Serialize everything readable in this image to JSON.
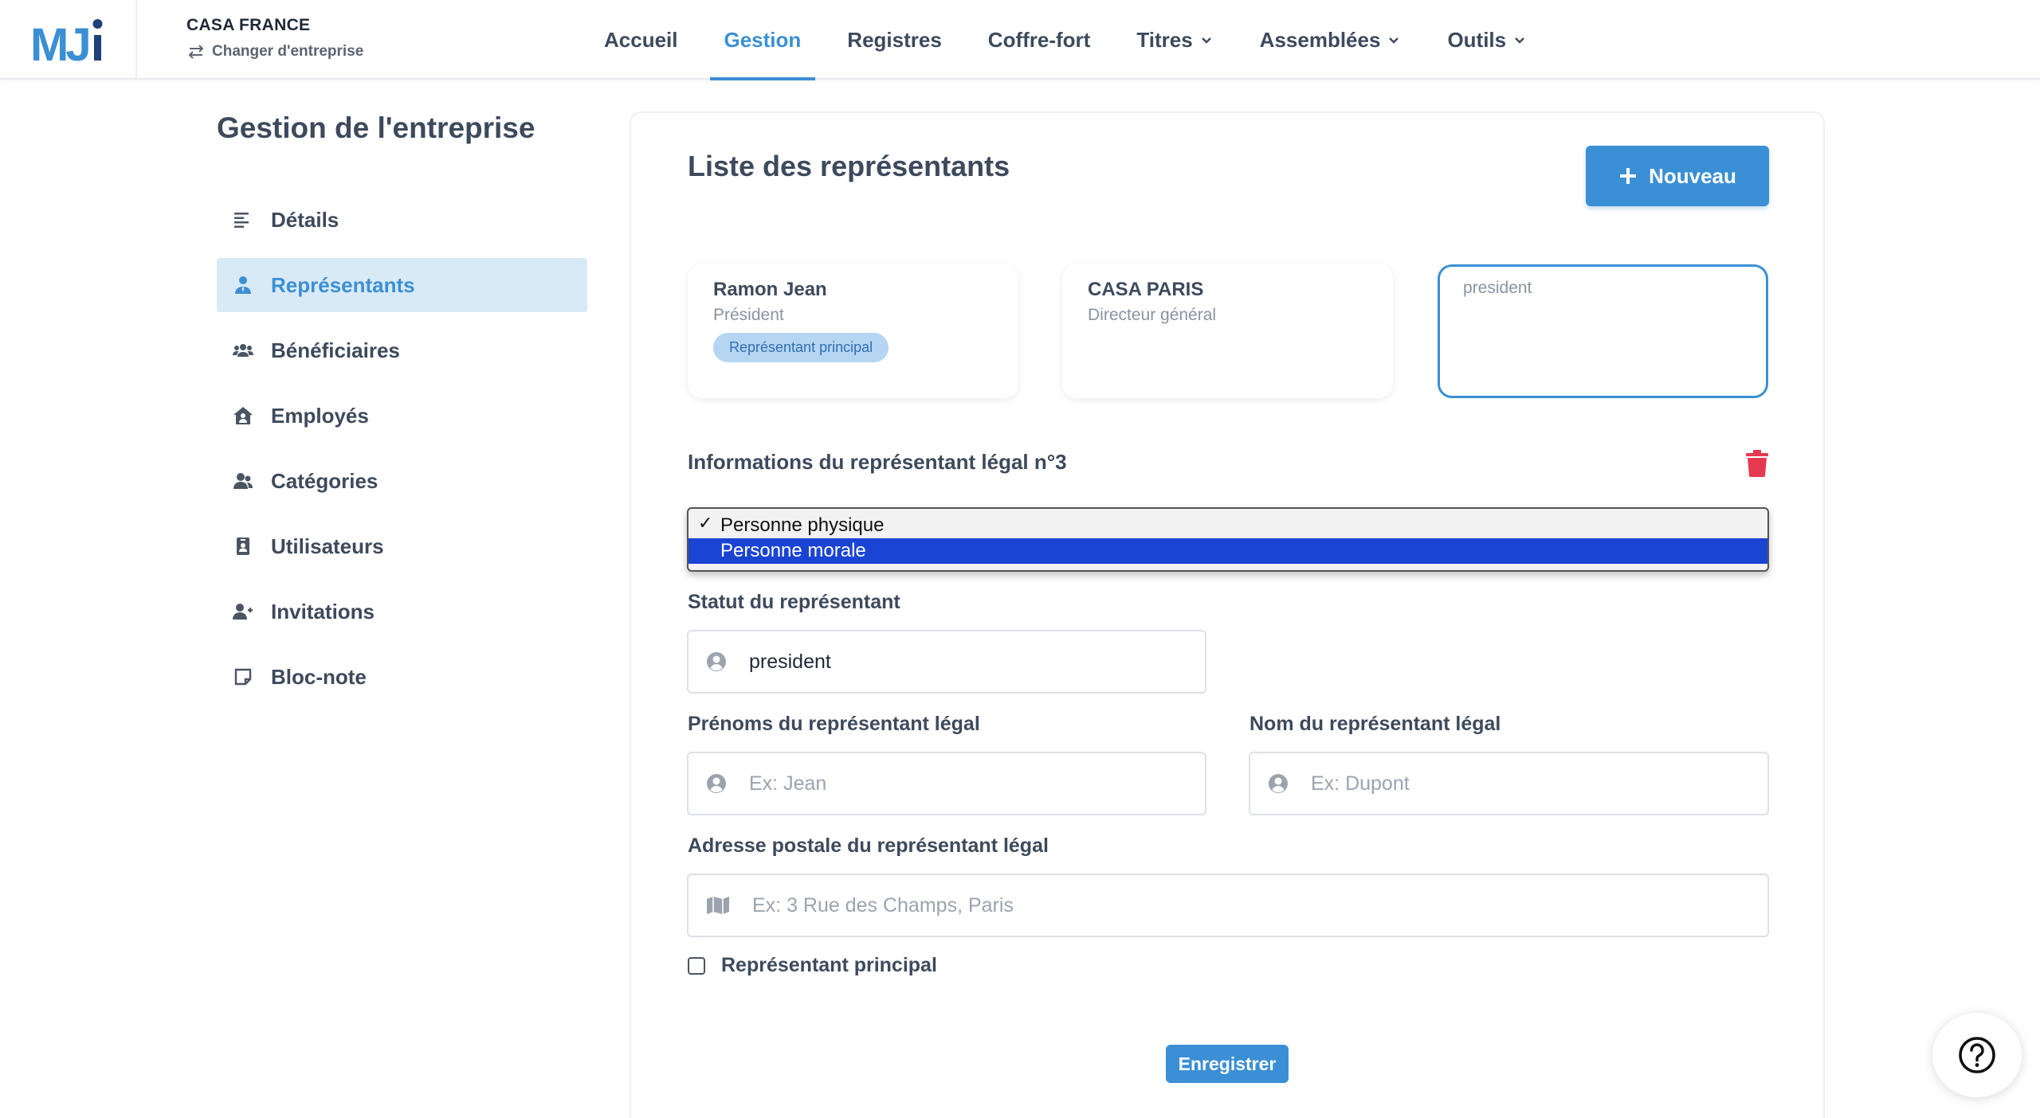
{
  "app": {
    "logo_text": "MJi",
    "company_name": "CASA FRANCE",
    "switch_company_label": "Changer d'entreprise"
  },
  "nav": {
    "items": [
      {
        "label": "Accueil",
        "active": false,
        "dropdown": false
      },
      {
        "label": "Gestion",
        "active": true,
        "dropdown": false
      },
      {
        "label": "Registres",
        "active": false,
        "dropdown": false
      },
      {
        "label": "Coffre-fort",
        "active": false,
        "dropdown": false
      },
      {
        "label": "Titres",
        "active": false,
        "dropdown": true
      },
      {
        "label": "Assemblées",
        "active": false,
        "dropdown": true
      },
      {
        "label": "Outils",
        "active": false,
        "dropdown": true
      }
    ]
  },
  "sidebar": {
    "title": "Gestion de l'entreprise",
    "items": [
      {
        "label": "Détails",
        "icon": "align-left-icon",
        "active": false
      },
      {
        "label": "Représentants",
        "icon": "user-tie-icon",
        "active": true
      },
      {
        "label": "Bénéficiaires",
        "icon": "users-icon",
        "active": false
      },
      {
        "label": "Employés",
        "icon": "house-user-icon",
        "active": false
      },
      {
        "label": "Catégories",
        "icon": "user-group-icon",
        "active": false
      },
      {
        "label": "Utilisateurs",
        "icon": "id-badge-icon",
        "active": false
      },
      {
        "label": "Invitations",
        "icon": "user-plus-icon",
        "active": false
      },
      {
        "label": "Bloc-note",
        "icon": "sticky-note-icon",
        "active": false
      }
    ]
  },
  "main": {
    "title": "Liste des représentants",
    "new_button_label": "Nouveau",
    "cards": [
      {
        "name": "Ramon Jean",
        "role": "Président",
        "badge": "Représentant principal"
      },
      {
        "name": "CASA PARIS",
        "role": "Directeur général",
        "badge": ""
      },
      {
        "name": "",
        "role": "president",
        "badge": ""
      }
    ],
    "section_title": "Informations du représentant légal n°3",
    "type_select": {
      "options": [
        "Personne physique",
        "Personne morale"
      ],
      "selected": "Personne physique",
      "highlighted": "Personne morale"
    },
    "status": {
      "label": "Statut du représentant",
      "value": "president"
    },
    "first_names": {
      "label": "Prénoms du représentant légal",
      "placeholder": "Ex: Jean"
    },
    "last_name": {
      "label": "Nom du représentant légal",
      "placeholder": "Ex: Dupont"
    },
    "address": {
      "label": "Adresse postale du représentant légal",
      "placeholder": "Ex: 3 Rue des Champs, Paris"
    },
    "principal_checkbox": {
      "label": "Représentant principal",
      "checked": false
    },
    "save_label": "Enregistrer"
  },
  "colors": {
    "accent": "#3b8fd4",
    "active_bg": "#d9eaf7",
    "danger": "#e53950",
    "select_highlight": "#1a44d4"
  }
}
